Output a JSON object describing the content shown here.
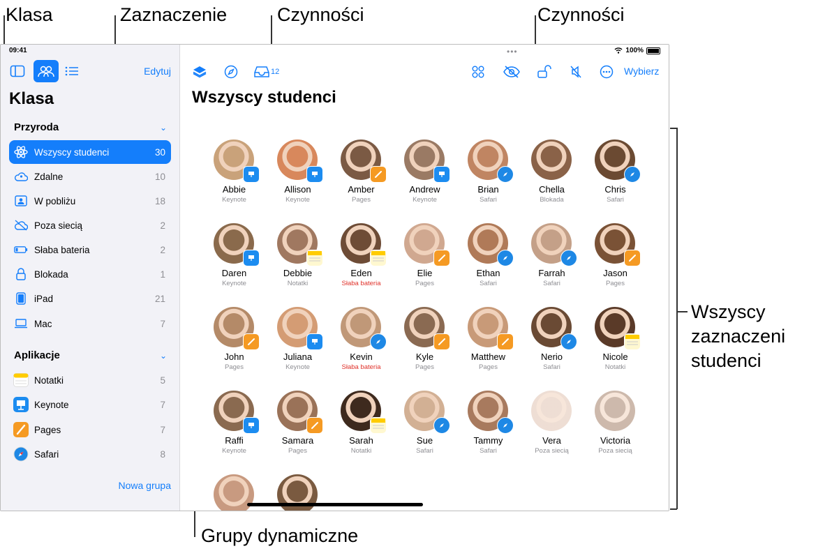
{
  "callouts": {
    "klasa": "Klasa",
    "zaznaczenie": "Zaznaczenie",
    "czynnosci_left": "Czynności",
    "czynnosci_right": "Czynności",
    "wszyscy_line1": "Wszyscy",
    "wszyscy_line2": "zaznaczeni",
    "wszyscy_line3": "studenci",
    "grupy": "Grupy dynamiczne"
  },
  "status": {
    "time": "09:41",
    "battery": "100%"
  },
  "sidebar": {
    "edit_label": "Edytuj",
    "title": "Klasa",
    "section1": "Przyroda",
    "items": [
      {
        "label": "Wszyscy studenci",
        "count": "30",
        "icon": "atom-icon"
      },
      {
        "label": "Zdalne",
        "count": "10",
        "icon": "cloud-person-icon"
      },
      {
        "label": "W pobliżu",
        "count": "18",
        "icon": "person-square-icon"
      },
      {
        "label": "Poza siecią",
        "count": "2",
        "icon": "cloud-slash-icon"
      },
      {
        "label": "Słaba bateria",
        "count": "2",
        "icon": "battery-low-icon"
      },
      {
        "label": "Blokada",
        "count": "1",
        "icon": "lock-icon"
      },
      {
        "label": "iPad",
        "count": "21",
        "icon": "ipad-icon"
      },
      {
        "label": "Mac",
        "count": "7",
        "icon": "laptop-icon"
      }
    ],
    "section2": "Aplikacje",
    "apps": [
      {
        "label": "Notatki",
        "count": "5",
        "icon": "notes-icon"
      },
      {
        "label": "Keynote",
        "count": "7",
        "icon": "keynote-icon"
      },
      {
        "label": "Pages",
        "count": "7",
        "icon": "pages-icon"
      },
      {
        "label": "Safari",
        "count": "8",
        "icon": "safari-icon"
      }
    ],
    "new_group": "Nowa grupa"
  },
  "toolbar": {
    "inbox_count": "12",
    "select_label": "Wybierz"
  },
  "main": {
    "title": "Wszyscy studenci"
  },
  "students": [
    {
      "name": "Abbie",
      "app": "Keynote",
      "badge": "keynote",
      "color": "#c9a27a"
    },
    {
      "name": "Allison",
      "app": "Keynote",
      "badge": "keynote",
      "color": "#d8885c"
    },
    {
      "name": "Amber",
      "app": "Pages",
      "badge": "pages",
      "color": "#7b5a44"
    },
    {
      "name": "Andrew",
      "app": "Keynote",
      "badge": "keynote",
      "color": "#9a7a64"
    },
    {
      "name": "Brian",
      "app": "Safari",
      "badge": "safari",
      "color": "#c08562"
    },
    {
      "name": "Chella",
      "app": "Blokada",
      "badge": "none",
      "color": "#8a6248"
    },
    {
      "name": "Chris",
      "app": "Safari",
      "badge": "safari",
      "color": "#6b4a32"
    },
    {
      "name": "Daren",
      "app": "Keynote",
      "badge": "keynote",
      "color": "#8a6a4c"
    },
    {
      "name": "Debbie",
      "app": "Notatki",
      "badge": "notes",
      "color": "#a07860"
    },
    {
      "name": "Eden",
      "app": "Słaba bateria",
      "badge": "notes",
      "color": "#6e4c36",
      "warn": true
    },
    {
      "name": "Elie",
      "app": "Pages",
      "badge": "pages",
      "color": "#d0a890"
    },
    {
      "name": "Ethan",
      "app": "Safari",
      "badge": "safari",
      "color": "#b07a58"
    },
    {
      "name": "Farrah",
      "app": "Safari",
      "badge": "safari",
      "color": "#c4a088"
    },
    {
      "name": "Jason",
      "app": "Pages",
      "badge": "pages",
      "color": "#7a5236"
    },
    {
      "name": "John",
      "app": "Pages",
      "badge": "pages",
      "color": "#b48a68"
    },
    {
      "name": "Juliana",
      "app": "Keynote",
      "badge": "keynote",
      "color": "#d49c74"
    },
    {
      "name": "Kevin",
      "app": "Słaba bateria",
      "badge": "safari",
      "color": "#c09878",
      "warn": true
    },
    {
      "name": "Kyle",
      "app": "Pages",
      "badge": "pages",
      "color": "#8a6a52"
    },
    {
      "name": "Matthew",
      "app": "Pages",
      "badge": "pages",
      "color": "#c89a78"
    },
    {
      "name": "Nerio",
      "app": "Safari",
      "badge": "safari",
      "color": "#6a4a34"
    },
    {
      "name": "Nicole",
      "app": "Notatki",
      "badge": "notes",
      "color": "#5a3a28"
    },
    {
      "name": "Raffi",
      "app": "Keynote",
      "badge": "keynote",
      "color": "#8a6a50"
    },
    {
      "name": "Samara",
      "app": "Pages",
      "badge": "pages",
      "color": "#9a7258"
    },
    {
      "name": "Sarah",
      "app": "Notatki",
      "badge": "notes",
      "color": "#3e2a1e"
    },
    {
      "name": "Sue",
      "app": "Safari",
      "badge": "safari",
      "color": "#d2b094"
    },
    {
      "name": "Tammy",
      "app": "Safari",
      "badge": "safari",
      "color": "#a87a5e"
    },
    {
      "name": "Vera",
      "app": "Poza siecią",
      "badge": "none",
      "color": "#e0c2b0",
      "faded": true
    },
    {
      "name": "Victoria",
      "app": "Poza siecią",
      "badge": "none",
      "color": "#a48068",
      "faded": true
    },
    {
      "name": "",
      "app": "",
      "badge": "none",
      "color": "#c89a80"
    },
    {
      "name": "",
      "app": "",
      "badge": "none",
      "color": "#7a5a40"
    }
  ]
}
